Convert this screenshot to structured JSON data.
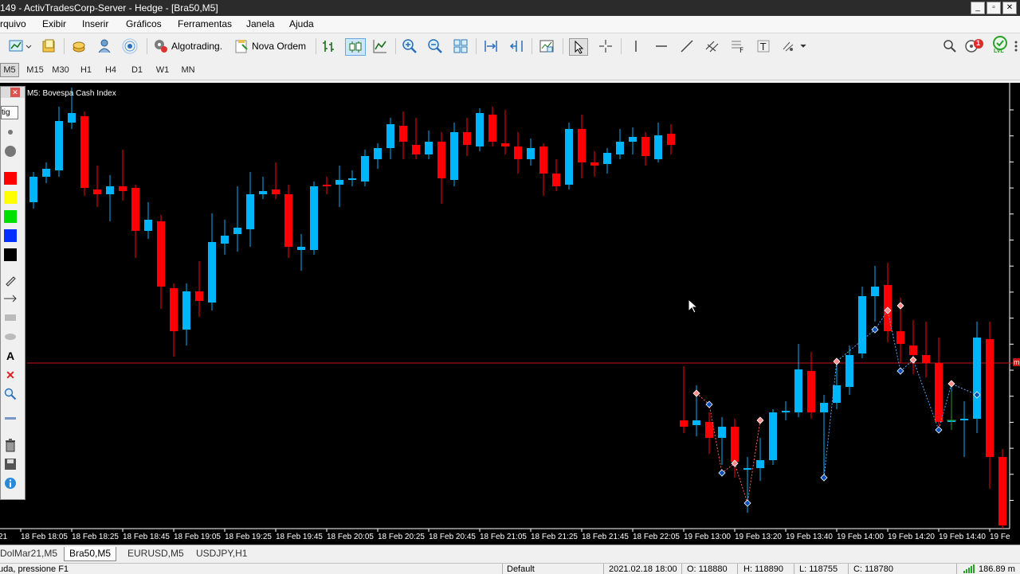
{
  "window": {
    "title": "149 - ActivTradesCorp-Server - Hedge - [Bra50,M5]"
  },
  "menu": [
    "rquivo",
    "Exibir",
    "Inserir",
    "Gráficos",
    "Ferramentas",
    "Janela",
    "Ajuda"
  ],
  "toolbar": {
    "algotrading": "Algotrading.",
    "new_order": "Nova Ordem",
    "alert_count": "1",
    "lvl": "LVL"
  },
  "timeframes": [
    "M5",
    "M15",
    "M30",
    "H1",
    "H4",
    "D1",
    "W1",
    "MN"
  ],
  "panel": {
    "tag": "tig"
  },
  "chart": {
    "label": "M5: Bovespa Cash Index",
    "bull_color": "#00b4ff",
    "bear_color": "#ff0000",
    "hline_color": "#c81414",
    "x_labels": [
      "21",
      "18 Feb 18:05",
      "18 Feb 18:25",
      "18 Feb 18:45",
      "18 Feb 19:05",
      "18 Feb 19:25",
      "18 Feb 19:45",
      "18 Feb 20:05",
      "18 Feb 20:25",
      "18 Feb 20:45",
      "18 Feb 21:05",
      "18 Feb 21:25",
      "18 Feb 21:45",
      "18 Feb 22:05",
      "19 Feb 13:00",
      "19 Feb 13:20",
      "19 Feb 13:40",
      "19 Feb 14:00",
      "19 Feb 14:20",
      "19 Feb 14:40",
      "19 Fe"
    ],
    "price_marker": "m"
  },
  "tabs": [
    "DolMar21,M5",
    "Bra50,M5",
    "EURUSD,M5",
    "USDJPY,H1"
  ],
  "status": {
    "help": "uda, pressione F1",
    "profile": "Default",
    "datetime": "2021.02.18 18:00",
    "open": "O: 118880",
    "high": "H: 118890",
    "low": "L: 118755",
    "close": "C: 118780",
    "traffic": "186.89 m"
  }
}
